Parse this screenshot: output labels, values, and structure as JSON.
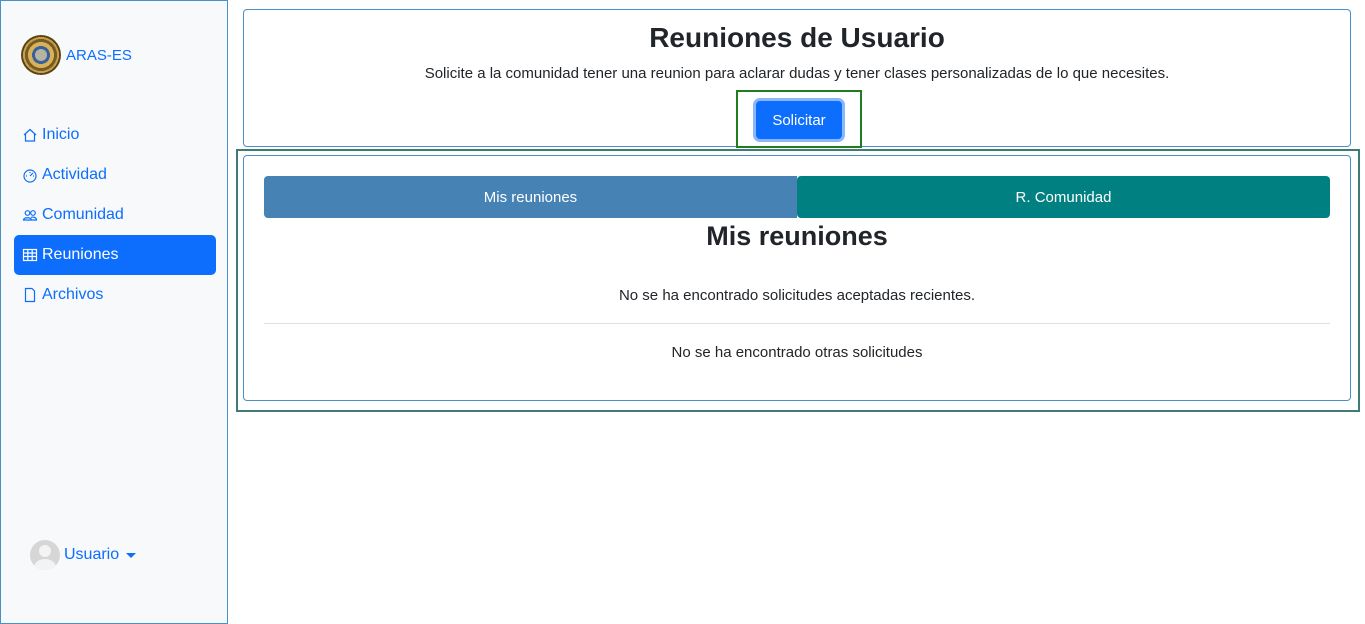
{
  "sidebar": {
    "brand": "ARAS-ES",
    "items": [
      {
        "label": "Inicio",
        "icon": "house-icon"
      },
      {
        "label": "Actividad",
        "icon": "speedometer-icon"
      },
      {
        "label": "Comunidad",
        "icon": "people-icon"
      },
      {
        "label": "Reuniones",
        "icon": "table-icon",
        "active": true
      },
      {
        "label": "Archivos",
        "icon": "file-icon"
      }
    ],
    "user": "Usuario"
  },
  "header": {
    "title": "Reuniones de Usuario",
    "subtitle": "Solicite a la comunidad tener una reunion para aclarar dudas y tener clases personalizadas de lo que necesites.",
    "button": "Solicitar"
  },
  "main": {
    "tabs": [
      "Mis reuniones",
      "R. Comunidad"
    ],
    "section_title": "Mis reuniones",
    "accepted_empty": "No se ha encontrado solicitudes aceptadas recientes.",
    "other_empty": "No se ha encontrado otras solicitudes"
  },
  "colors": {
    "primary": "#0d6efd",
    "tab_mine": "#4682b4",
    "tab_community": "#008080"
  }
}
